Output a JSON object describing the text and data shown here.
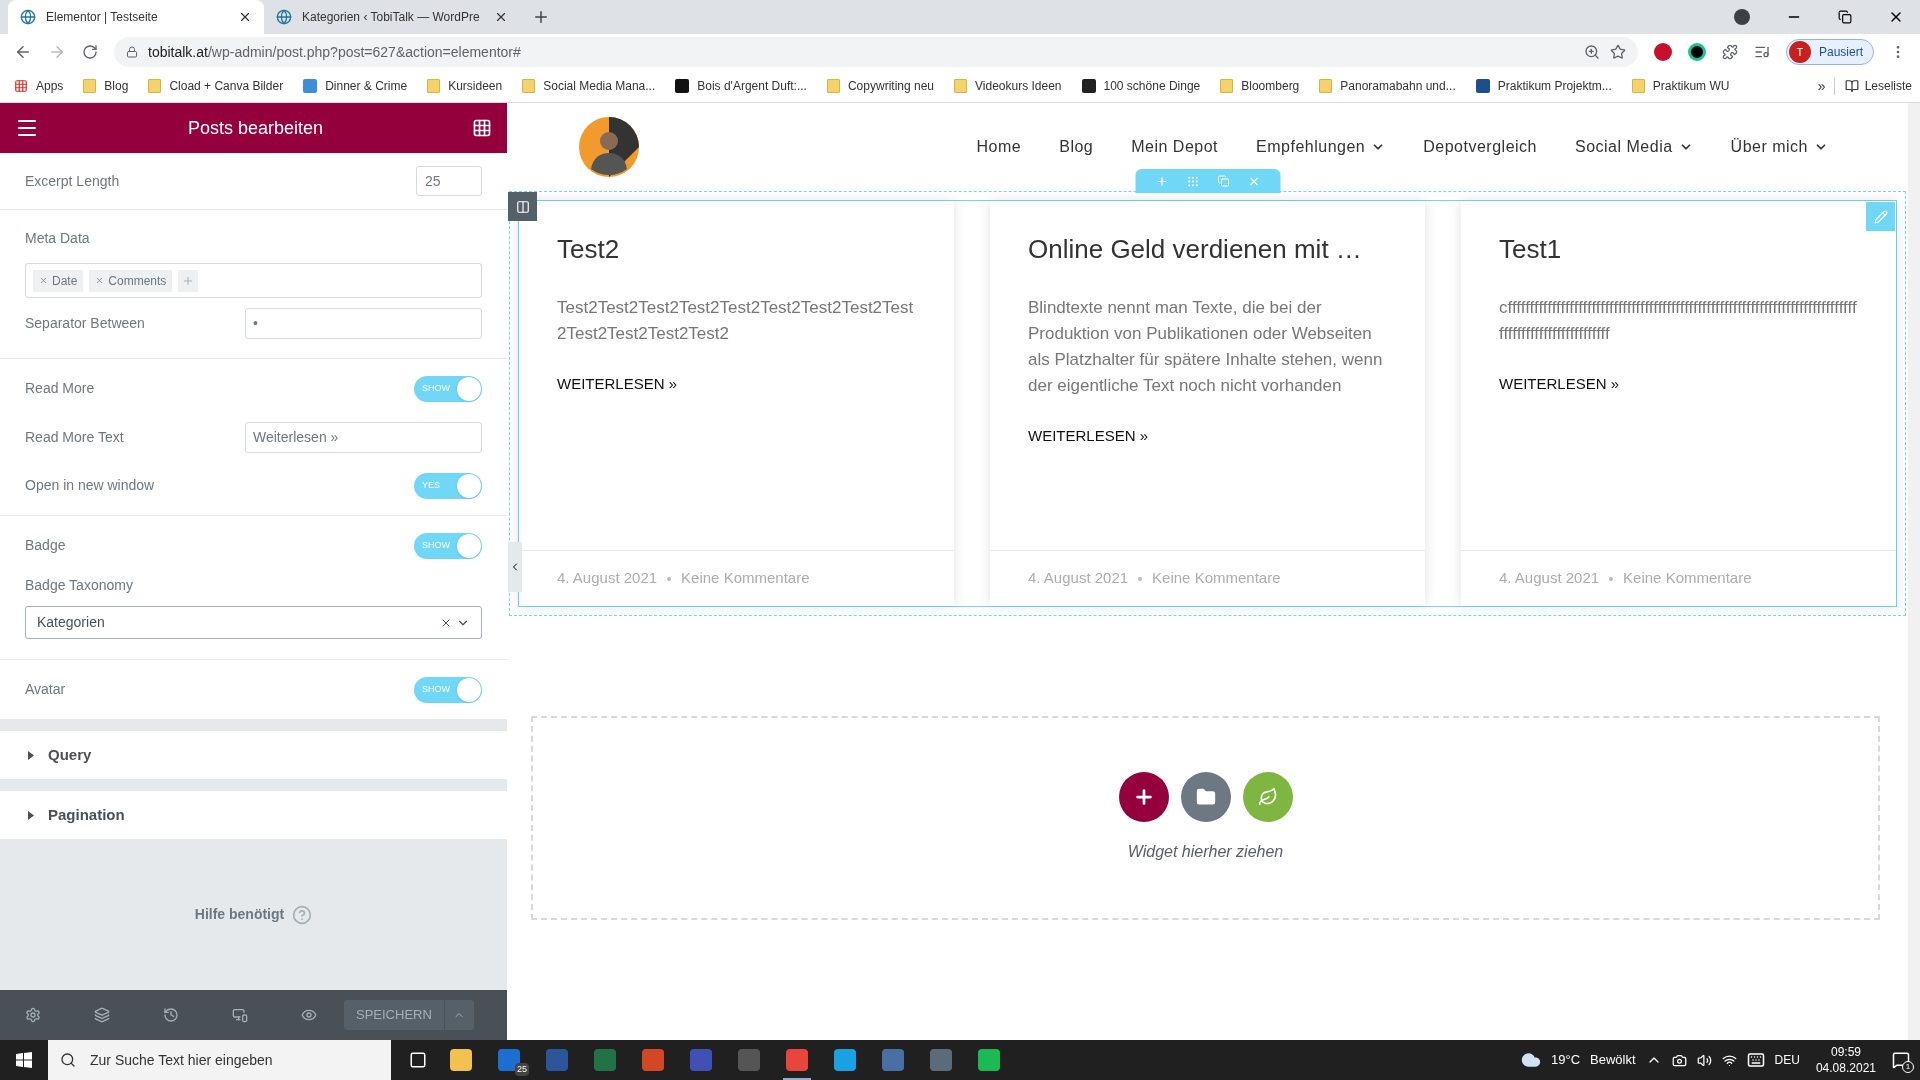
{
  "browser": {
    "tabs": [
      {
        "title": "Elementor | Testseite",
        "selected": true
      },
      {
        "title": "Kategorien ‹ TobiTalk — WordPre",
        "selected": false
      }
    ],
    "url_host": "tobitalk.at",
    "url_path": "/wp-admin/post.php?post=627&action=elementor#",
    "profile_initial": "T",
    "profile_label": "Pausiert",
    "bookmarks": [
      {
        "label": "Apps",
        "kind": "apps"
      },
      {
        "label": "Blog",
        "kind": "folder"
      },
      {
        "label": "Cload + Canva Bilder",
        "kind": "folder"
      },
      {
        "label": "Dinner & Crime",
        "kind": "site",
        "color": "#3b8ed8"
      },
      {
        "label": "Kursideen",
        "kind": "folder"
      },
      {
        "label": "Social Media Mana...",
        "kind": "folder"
      },
      {
        "label": "Bois d'Argent Duft:...",
        "kind": "site",
        "color": "#111111"
      },
      {
        "label": "Copywriting neu",
        "kind": "folder"
      },
      {
        "label": "Videokurs Ideen",
        "kind": "folder"
      },
      {
        "label": "100 schöne Dinge",
        "kind": "site",
        "color": "#222222"
      },
      {
        "label": "Bloomberg",
        "kind": "folder"
      },
      {
        "label": "Panoramabahn und...",
        "kind": "folder"
      },
      {
        "label": "Praktikum Projektm...",
        "kind": "site",
        "color": "#1d4f8c"
      },
      {
        "label": "Praktikum WU",
        "kind": "folder"
      }
    ],
    "more_bookmarks": "»",
    "reading_list": "Leseliste"
  },
  "panel": {
    "title": "Posts bearbeiten",
    "groups": [
      [
        {
          "kind": "number",
          "label": "Excerpt Length",
          "value": "25"
        }
      ],
      [
        {
          "kind": "tags",
          "label": "Meta Data",
          "tags": [
            "Date",
            "Comments"
          ]
        },
        {
          "kind": "text",
          "label": "Separator Between",
          "value": "•"
        }
      ],
      [
        {
          "kind": "toggle",
          "label": "Read More",
          "on": true,
          "switch_text": "SHOW"
        },
        {
          "kind": "text",
          "label": "Read More Text",
          "value": "Weiterlesen »"
        },
        {
          "kind": "toggle",
          "label": "Open in new window",
          "on": true,
          "switch_text": "YES"
        }
      ],
      [
        {
          "kind": "toggle",
          "label": "Badge",
          "on": true,
          "switch_text": "SHOW"
        },
        {
          "kind": "select",
          "label": "Badge Taxonomy",
          "value": "Kategorien"
        }
      ],
      [
        {
          "kind": "toggle",
          "label": "Avatar",
          "on": true,
          "switch_text": "SHOW"
        }
      ]
    ],
    "sections": [
      {
        "label": "Query",
        "expanded": false
      },
      {
        "label": "Pagination",
        "expanded": false
      }
    ],
    "help": "Hilfe benötigt",
    "save": "SPEICHERN"
  },
  "preview": {
    "nav": [
      {
        "label": "Home",
        "dropdown": false
      },
      {
        "label": "Blog",
        "dropdown": false
      },
      {
        "label": "Mein Depot",
        "dropdown": false
      },
      {
        "label": "Empfehlungen",
        "dropdown": true
      },
      {
        "label": "Depotvergleich",
        "dropdown": false
      },
      {
        "label": "Social Media",
        "dropdown": true
      },
      {
        "label": "Über mich",
        "dropdown": true
      }
    ],
    "posts": [
      {
        "title": "Test2",
        "excerpt": "Test2Test2Test2Test2Test2Test2Test2Test2Test2Test2Test2Test2Test2",
        "read_more": "WEITERLESEN »",
        "date": "4. August 2021",
        "comments": "Keine Kommentare"
      },
      {
        "title": "Online Geld verdienen mit …",
        "excerpt": "Blindtexte nennt man Texte, die bei der Produktion von Publikationen oder Webseiten als Platzhalter für spätere Inhalte stehen, wenn der eigentliche Text noch nicht vorhanden",
        "read_more": "WEITERLESEN »",
        "date": "4. August 2021",
        "comments": "Keine Kommentare"
      },
      {
        "title": "Test1",
        "excerpt": "cffffffffffffffffffffffffffffffffffffffffffffffffffffffffffffffffffffffffffffffffffffffffffffffffffffffff",
        "read_more": "WEITERLESEN »",
        "date": "4. August 2021",
        "comments": "Keine Kommentare"
      }
    ],
    "drop_caption": "Widget hierher ziehen"
  },
  "taskbar": {
    "search_placeholder": "Zur Suche Text hier eingeben",
    "mail_badge": "25",
    "apps": [
      {
        "color": "#f2c14e"
      },
      {
        "color": "#1c6fd1"
      },
      {
        "color": "#2b579a"
      },
      {
        "color": "#217346"
      },
      {
        "color": "#d24726"
      },
      {
        "color": "#3f51b5"
      },
      {
        "color": "#555555"
      },
      {
        "color": "#e8453c",
        "selected": true
      },
      {
        "color": "#1ba1e2"
      },
      {
        "color": "#4a6fa5"
      },
      {
        "color": "#5c6b7a"
      },
      {
        "color": "#1db954"
      }
    ],
    "temperature": "19°C",
    "weather": "Bewölkt",
    "language": "DEU",
    "time": "09:59",
    "date": "04.08.2021",
    "notifications": "1"
  }
}
